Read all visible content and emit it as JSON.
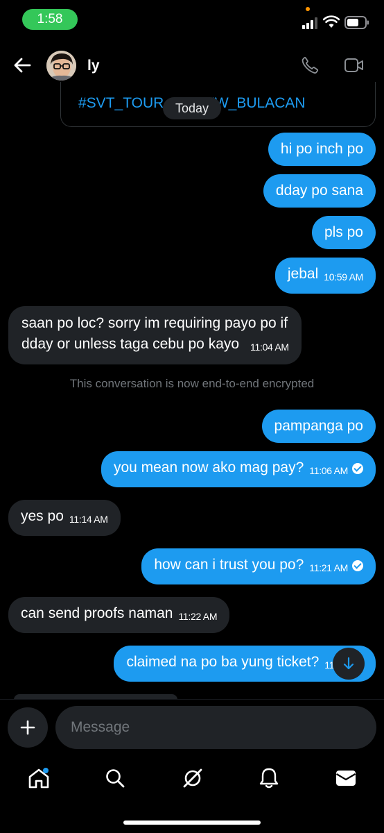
{
  "status_bar": {
    "time": "1:58"
  },
  "header": {
    "contact_name": "ly"
  },
  "shared_card": {
    "hashtag": "#SVT_TOUR_IN_NEW_BULACAN"
  },
  "date_divider": "Today",
  "messages": [
    {
      "from": "me",
      "text": "hi po inch po",
      "time": "",
      "read": false
    },
    {
      "from": "me",
      "text": "dday po sana",
      "time": "",
      "read": false
    },
    {
      "from": "me",
      "text": "pls po",
      "time": "",
      "read": false
    },
    {
      "from": "me",
      "text": "jebal",
      "time": "10:59 AM",
      "read": false
    },
    {
      "from": "them",
      "text": "saan po loc? sorry im requiring payo po if",
      "text2": "dday or unless taga cebu po kayo",
      "time": "11:04 AM"
    },
    {
      "from": "me",
      "text": "pampanga po",
      "time": "",
      "read": false
    },
    {
      "from": "me",
      "text": "you mean now ako mag pay?",
      "time": "11:06 AM",
      "read": true
    },
    {
      "from": "them",
      "text": "yes po",
      "time": "11:14 AM"
    },
    {
      "from": "me",
      "text": "how can i trust you po?",
      "time": "11:21 AM",
      "read": true
    },
    {
      "from": "them",
      "text": "can send proofs naman",
      "time": "11:22 AM"
    },
    {
      "from": "me",
      "text": "claimed na po ba yung ticket?",
      "time": "11:22 AM",
      "read": false
    }
  ],
  "encryption_notice": "This conversation is now end-to-end encrypted",
  "composer": {
    "placeholder": "Message"
  },
  "bottom_nav": [
    "home-icon",
    "search-icon",
    "grok-icon",
    "notifications-icon",
    "messages-icon"
  ],
  "colors": {
    "accent": "#1d9bf0",
    "received_bubble": "#202327",
    "status_pill": "#34c759"
  }
}
